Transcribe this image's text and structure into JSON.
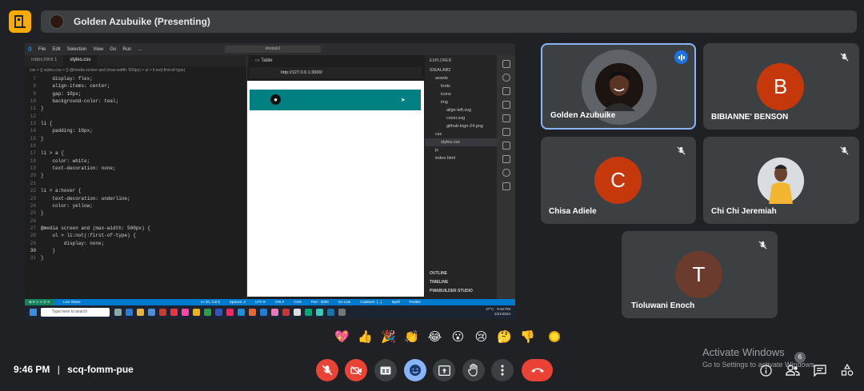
{
  "header": {
    "presenting_text": "Golden Azubuike (Presenting)"
  },
  "share": {
    "vscode": {
      "menu": [
        "File",
        "Edit",
        "Selection",
        "View",
        "Go",
        "Run",
        "..."
      ],
      "search": "idealab2",
      "tabs": [
        "index.html 1",
        "styles.css"
      ],
      "breadcrumb": "css > {} styles.css > {} @media screen and (max-width: 500px) > ul > li:not(:first-of-type)",
      "code": [
        {
          "n": "7",
          "t": "    display: flex;"
        },
        {
          "n": "8",
          "t": "    align-items: center;"
        },
        {
          "n": "9",
          "t": "    gap: 10px;"
        },
        {
          "n": "10",
          "t": "    background-color: teal;"
        },
        {
          "n": "11",
          "t": "}"
        },
        {
          "n": "12",
          "t": ""
        },
        {
          "n": "13",
          "t": "li {"
        },
        {
          "n": "14",
          "t": "    padding: 10px;"
        },
        {
          "n": "15",
          "t": "}"
        },
        {
          "n": "16",
          "t": ""
        },
        {
          "n": "17",
          "t": "li > a {"
        },
        {
          "n": "18",
          "t": "    color: white;"
        },
        {
          "n": "19",
          "t": "    text-decoration: none;"
        },
        {
          "n": "20",
          "t": "}"
        },
        {
          "n": "21",
          "t": ""
        },
        {
          "n": "22",
          "t": "li > a:hover {"
        },
        {
          "n": "23",
          "t": "    text-decoration: underline;"
        },
        {
          "n": "24",
          "t": "    color: yellow;"
        },
        {
          "n": "25",
          "t": "}"
        },
        {
          "n": "26",
          "t": ""
        },
        {
          "n": "27",
          "t": "@media screen and (max-width: 500px) {"
        },
        {
          "n": "28",
          "t": "    ul > li:not(:first-of-type) {"
        },
        {
          "n": "29",
          "t": "        display: none;"
        },
        {
          "n": "30",
          "t": "    }"
        },
        {
          "n": "31",
          "t": "}"
        }
      ],
      "preview_tab": "Table",
      "preview_url": "http://127.0.0.1:3000/",
      "explorer_title": "EXPLORER",
      "explorer": [
        {
          "label": "IDEALAB2",
          "indent": 0
        },
        {
          "label": "assets",
          "indent": 1
        },
        {
          "label": "fonts",
          "indent": 2
        },
        {
          "label": "icons",
          "indent": 2
        },
        {
          "label": "img",
          "indent": 2
        },
        {
          "label": "align-left.svg",
          "indent": 3
        },
        {
          "label": "cover.svg",
          "indent": 3
        },
        {
          "label": "github-logo-24.png",
          "indent": 3
        },
        {
          "label": "css",
          "indent": 1
        },
        {
          "label": "styles.css",
          "indent": 2,
          "selected": true
        },
        {
          "label": "js",
          "indent": 1
        },
        {
          "label": "index.html",
          "indent": 1
        }
      ],
      "explorer_bottom": [
        "OUTLINE",
        "TIMELINE",
        "PWABUILDER STUDIO"
      ],
      "status": {
        "left": "⊗ 0 ⚠ 1  ⓦ 0",
        "live": "Live Share",
        "position": "Ln 30, Col 5",
        "spaces": "Spaces: 4",
        "encoding": "UTF-8",
        "eol": "CRLF",
        "lang": "CSS",
        "port": "Port : 3000",
        "golive": "Go Live",
        "codeium": "Codeium: {...}",
        "spell": "Spell",
        "prettier": "Prettier"
      },
      "taskbar": {
        "search": "Type here to search",
        "weather": "27°C",
        "time": "9:46 PM",
        "date": "2/21/2024"
      }
    }
  },
  "participants": [
    {
      "name": "Golden Azubuike",
      "initial": "",
      "color": "#202124",
      "speaking": true,
      "muted": false
    },
    {
      "name": "BIBIANNE' BENSON",
      "initial": "B",
      "color": "#c5380c",
      "speaking": false,
      "muted": true
    },
    {
      "name": "Chisa Adiele",
      "initial": "C",
      "color": "#c5380c",
      "speaking": false,
      "muted": true
    },
    {
      "name": "Chi Chi Jeremiah",
      "initial": "",
      "color": "#d9dde2",
      "speaking": false,
      "muted": true
    },
    {
      "name": "Tioluwani Enoch",
      "initial": "T",
      "color": "#6b3b2e",
      "speaking": false,
      "muted": true
    }
  ],
  "reactions": [
    "💖",
    "👍",
    "🎉",
    "👏",
    "😂",
    "😮",
    "😢",
    "🤔",
    "👎"
  ],
  "footer": {
    "time": "9:46 PM",
    "separator": "|",
    "meeting_code": "scq-fomm-pue",
    "people_count": "6",
    "watermark_title": "Activate Windows",
    "watermark_sub": "Go to Settings to activate Windows."
  },
  "colors": {
    "background": "#202124",
    "tile": "#3c4043",
    "danger": "#ea4335",
    "accent": "#8ab4f8",
    "home": "#f9ab00"
  }
}
